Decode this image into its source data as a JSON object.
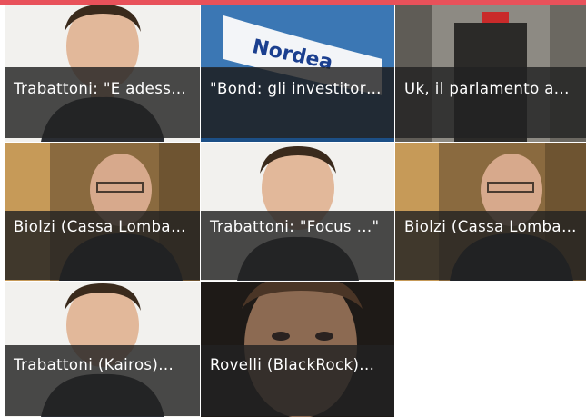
{
  "accent_color": "#e8515a",
  "tiles": [
    {
      "title": "Trabattoni: \"E adesso...\"",
      "image": "portrait-man-dark-hair"
    },
    {
      "title": "\"Bond: gli investitori...\"",
      "image": "nordea-flag"
    },
    {
      "title": "Uk, il parlamento a...",
      "image": "ubs-building"
    },
    {
      "title": "Biolzi (Cassa Lombarda)...",
      "image": "portrait-man-glasses"
    },
    {
      "title": "Trabattoni: \"Focus ...\"",
      "image": "portrait-man-dark-hair"
    },
    {
      "title": "Biolzi (Cassa Lombarda)...",
      "image": "portrait-man-glasses"
    },
    {
      "title": "Trabattoni (Kairos)...",
      "image": "portrait-man-dark-hair"
    },
    {
      "title": "Rovelli (BlackRock)...",
      "image": "portrait-man-closeup"
    }
  ]
}
